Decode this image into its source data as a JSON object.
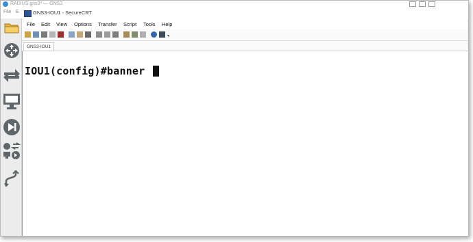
{
  "gns3": {
    "title": "RADIUS.gns3* — GNS3",
    "menu": [
      "File"
    ],
    "separator": "E"
  },
  "securecrt": {
    "title": "GNS3-IOU1 - SecureCRT",
    "menu": [
      "File",
      "Edit",
      "View",
      "Options",
      "Transfer",
      "Script",
      "Tools",
      "Help"
    ],
    "tab_label": "GNS3-IOU1",
    "terminal_text": "IOU1(config)#banner "
  },
  "left_toolbar_icons": [
    "router-icon",
    "switch-icon",
    "end-device-icon",
    "play-icon",
    "all-devices-icon",
    "link-icon"
  ],
  "colors": {
    "toolbar_bg": "#ececec",
    "terminal_bg": "#ffffff",
    "terminal_fg": "#111111",
    "icon_gray": "#5f6669"
  }
}
